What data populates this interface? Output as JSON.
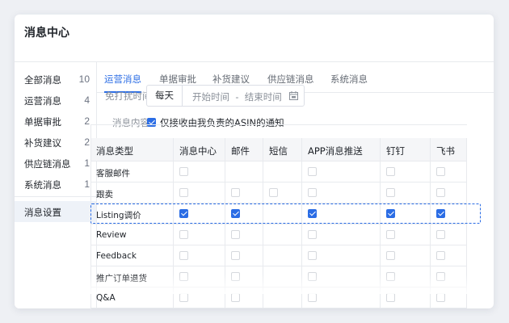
{
  "title": "消息中心",
  "sidebar": {
    "items": [
      {
        "label": "全部消息",
        "count": "10"
      },
      {
        "label": "运营消息",
        "count": "4"
      },
      {
        "label": "单据审批",
        "count": "2"
      },
      {
        "label": "补货建议",
        "count": "2"
      },
      {
        "label": "供应链消息",
        "count": "1"
      },
      {
        "label": "系统消息",
        "count": "1"
      }
    ],
    "settings_label": "消息设置"
  },
  "tabs": [
    "运营消息",
    "单据审批",
    "补货建议",
    "供应链消息",
    "系统消息"
  ],
  "active_tab": "运营消息",
  "dnd": {
    "label": "免打扰时间:",
    "daily": "每天",
    "start": "开始时间",
    "sep": "-",
    "end": "结束时间"
  },
  "content": {
    "label": "消息内容:",
    "asin_only": "仅接收由我负责的ASIN的通知",
    "asin_only_checked": true
  },
  "table": {
    "headers": [
      "消息类型",
      "消息中心",
      "邮件",
      "短信",
      "APP消息推送",
      "钉钉",
      "飞书"
    ],
    "rows": [
      {
        "type": "客服邮件",
        "checks": [
          false,
          null,
          null,
          false,
          false,
          false
        ],
        "highlight": false
      },
      {
        "type": "跟卖",
        "checks": [
          false,
          false,
          false,
          false,
          false,
          false
        ],
        "highlight": false
      },
      {
        "type": "Listing调价",
        "checks": [
          true,
          true,
          null,
          true,
          true,
          true
        ],
        "highlight": true
      },
      {
        "type": "Review",
        "checks": [
          false,
          false,
          null,
          false,
          false,
          false
        ],
        "highlight": false
      },
      {
        "type": "Feedback",
        "checks": [
          false,
          false,
          null,
          false,
          false,
          false
        ],
        "highlight": false
      },
      {
        "type": "推广订单退货",
        "checks": [
          false,
          false,
          null,
          false,
          false,
          false
        ],
        "highlight": false
      },
      {
        "type": "Q&A",
        "checks": [
          false,
          false,
          null,
          false,
          false,
          false
        ],
        "highlight": false
      }
    ]
  },
  "colors": {
    "accent": "#2b6de5",
    "sidebar_active": "#eef2f8"
  }
}
